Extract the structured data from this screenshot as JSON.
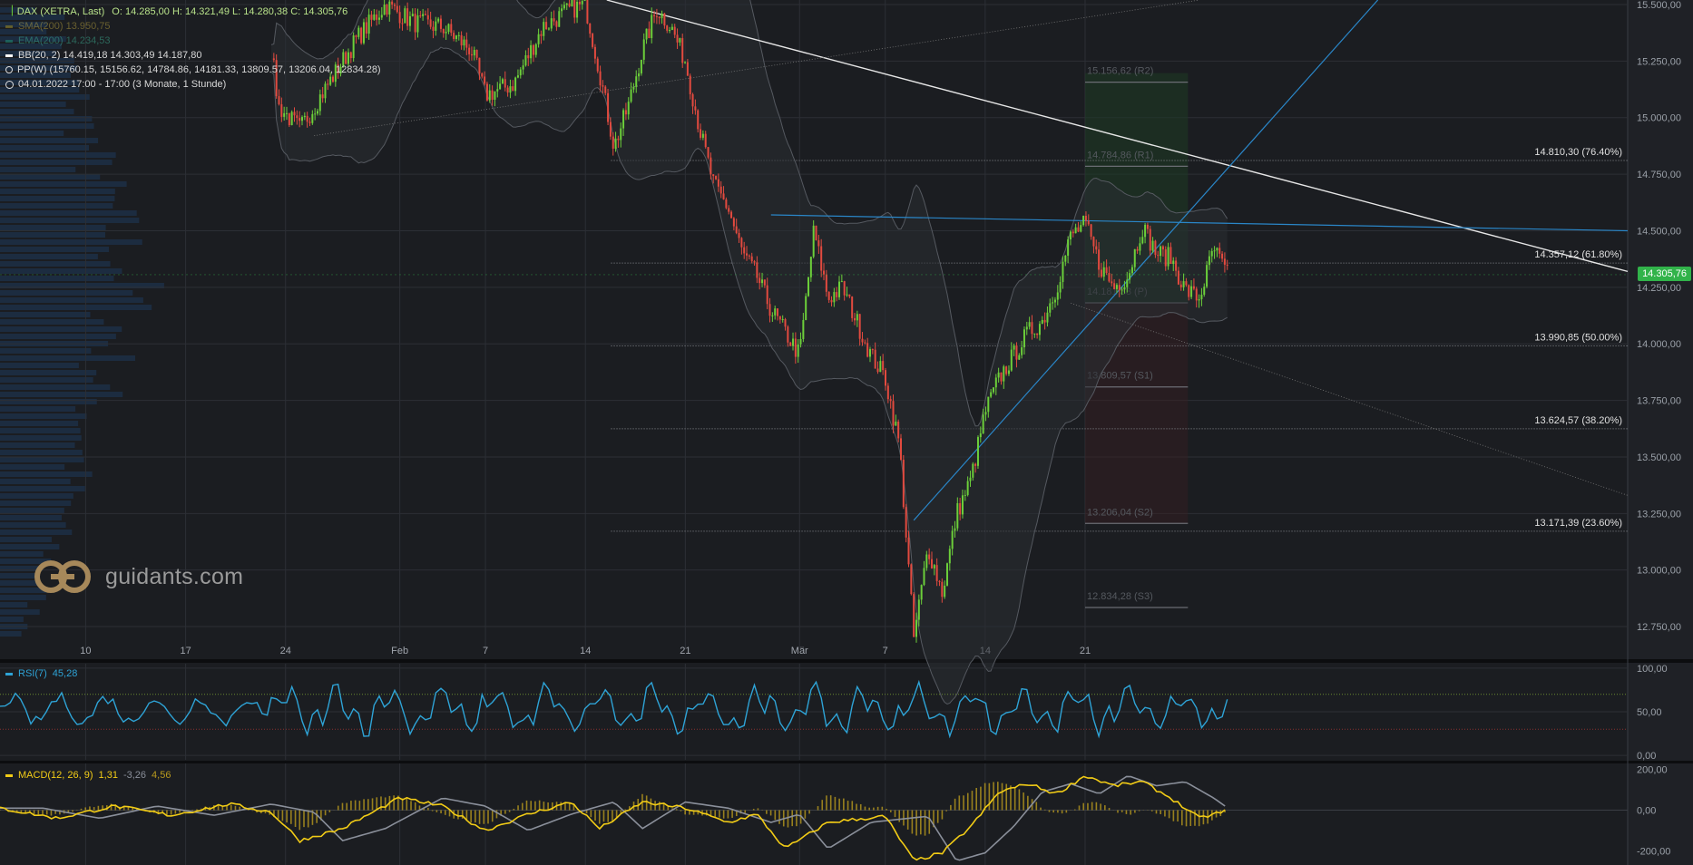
{
  "colors": {
    "bg": "#1b1d21",
    "grid": "#2c2f35",
    "up": "#6ccf3a",
    "down": "#e24a3f",
    "rsi": "#2ea3d6",
    "macd": "#f2cc16",
    "signal": "#8a8f9a",
    "hist": "#b89a1e",
    "trend": "#2a86c8",
    "white": "#e6e6e6",
    "pp_green": "#1e3a24",
    "pp_red": "#3a1e22"
  },
  "legend": {
    "instrument": "DAX (XETRA, Last)",
    "ohlc": "O: 14.285,00  H: 14.321,49  L: 14.280,38  C: 14.305,76",
    "sma": "SMA(200)  13.950,75",
    "ema": "EMA(200)  14.234,53",
    "bb": "BB(20, 2)  14.419,18  14.303,49  14.187,80",
    "pp": "PP(W)  (15760.15, 15156.62, 14784.86, 14181.33, 13809.57, 13206.04, 12834.28)",
    "range": "04.01.2022 17:00 - 17:00   (3 Monate, 1 Stunde)"
  },
  "logo_text": "guidants.com",
  "last_price_label": "14.305,76",
  "rsi_legend": {
    "name": "RSI(7)",
    "value": "45,28"
  },
  "macd_legend": {
    "name": "MACD(12, 26, 9)",
    "v1": "1,31",
    "v2": "-3,26",
    "v3": "4,56"
  },
  "fib_labels": [
    "14.810,30 (76.40%)",
    "14.357,12 (61.80%)",
    "13.990,85 (50.00%)",
    "13.624,57 (38.20%)",
    "13.171,39 (23.60%)"
  ],
  "pp_labels": [
    "15.156,62 (R2)",
    "14.784,86 (R1)",
    "14.181,33 (P)",
    "13.809,57 (S1)",
    "13.206,04 (S2)",
    "12.834,28 (S3)"
  ],
  "chart_data": [
    {
      "type": "candlestick",
      "title": "DAX (XETRA, Last)",
      "ylim": [
        12650,
        15520
      ],
      "y_ticks": [
        "15.500,00",
        "15.250,00",
        "15.000,00",
        "14.750,00",
        "14.500,00",
        "14.250,00",
        "14.000,00",
        "13.750,00",
        "13.500,00",
        "13.250,00",
        "13.000,00",
        "12.750,00"
      ],
      "y_tick_values": [
        15500,
        15250,
        15000,
        14750,
        14500,
        14250,
        14000,
        13750,
        13500,
        13250,
        13000,
        12750
      ],
      "x_tick_labels": [
        "10",
        "17",
        "24",
        "Feb",
        "7",
        "14",
        "21",
        "Mär",
        "7",
        "14",
        "21"
      ],
      "x_tick_days": [
        6,
        13,
        20,
        28,
        34,
        41,
        48,
        56,
        62,
        69,
        76
      ],
      "day_range": [
        0,
        114
      ],
      "price_path": [
        [
          19,
          15300
        ],
        [
          19.5,
          15050
        ],
        [
          21,
          14950
        ],
        [
          23,
          15150
        ],
        [
          25,
          15350
        ],
        [
          27,
          15500
        ],
        [
          29,
          15420
        ],
        [
          31,
          15400
        ],
        [
          33,
          15300
        ],
        [
          34,
          15100
        ],
        [
          36,
          15150
        ],
        [
          38,
          15400
        ],
        [
          40,
          15480
        ],
        [
          41,
          15500
        ],
        [
          42,
          15200
        ],
        [
          43,
          14870
        ],
        [
          44,
          15050
        ],
        [
          45,
          15300
        ],
        [
          46,
          15480
        ],
        [
          47,
          15400
        ],
        [
          48,
          15250
        ],
        [
          49,
          14950
        ],
        [
          50,
          14700
        ],
        [
          51,
          14600
        ],
        [
          52,
          14400
        ],
        [
          53,
          14300
        ],
        [
          54,
          14150
        ],
        [
          55,
          14050
        ],
        [
          56,
          13950
        ],
        [
          57,
          14500
        ],
        [
          58,
          14200
        ],
        [
          59,
          14250
        ],
        [
          60,
          14100
        ],
        [
          61,
          13950
        ],
        [
          62,
          13850
        ],
        [
          63,
          13550
        ],
        [
          64,
          12700
        ],
        [
          65,
          13100
        ],
        [
          66,
          12900
        ],
        [
          67,
          13250
        ],
        [
          68,
          13400
        ],
        [
          69,
          13700
        ],
        [
          70,
          13850
        ],
        [
          71,
          13950
        ],
        [
          72,
          14050
        ],
        [
          73,
          14100
        ],
        [
          74,
          14250
        ],
        [
          75,
          14480
        ],
        [
          76,
          14530
        ],
        [
          77,
          14350
        ],
        [
          78,
          14250
        ],
        [
          79,
          14300
        ],
        [
          80,
          14520
        ],
        [
          81,
          14400
        ],
        [
          82,
          14380
        ],
        [
          83,
          14240
        ],
        [
          84,
          14200
        ],
        [
          85,
          14420
        ],
        [
          86,
          14300
        ]
      ],
      "fib_levels": [
        14810.3,
        14357.12,
        13990.85,
        13624.57,
        13171.39
      ],
      "pivot_points": [
        15156.62,
        14784.86,
        14181.33,
        13809.57,
        13206.04,
        12834.28
      ],
      "last_price": 14305.76
    },
    {
      "type": "line",
      "title": "RSI(7)",
      "ylim": [
        -5,
        105
      ],
      "y_ticks": [
        "100,00",
        "50,00",
        "0,00"
      ],
      "y_tick_values": [
        100,
        50,
        0
      ],
      "levels": [
        70,
        30
      ],
      "last_value": 45.28
    },
    {
      "type": "line",
      "title": "MACD(12, 26, 9)",
      "ylim": [
        -270,
        230
      ],
      "y_ticks": [
        "200,00",
        "0,00",
        "-200,00"
      ],
      "y_tick_values": [
        200,
        0,
        -200
      ],
      "macd_path": [
        [
          0,
          10
        ],
        [
          4,
          -40
        ],
        [
          8,
          20
        ],
        [
          12,
          -25
        ],
        [
          16,
          30
        ],
        [
          19,
          -10
        ],
        [
          21,
          -150
        ],
        [
          24,
          -90
        ],
        [
          28,
          60
        ],
        [
          31,
          20
        ],
        [
          34,
          -100
        ],
        [
          37,
          -20
        ],
        [
          40,
          40
        ],
        [
          42,
          -90
        ],
        [
          45,
          40
        ],
        [
          48,
          10
        ],
        [
          51,
          -60
        ],
        [
          53,
          -20
        ],
        [
          55,
          -190
        ],
        [
          58,
          -60
        ],
        [
          62,
          -30
        ],
        [
          64,
          -250
        ],
        [
          66,
          -210
        ],
        [
          68,
          -80
        ],
        [
          70,
          90
        ],
        [
          72,
          130
        ],
        [
          74,
          80
        ],
        [
          76,
          170
        ],
        [
          78,
          120
        ],
        [
          80,
          140
        ],
        [
          82,
          60
        ],
        [
          84,
          -40
        ],
        [
          86,
          0
        ]
      ],
      "signal_lag": 1.2
    }
  ]
}
